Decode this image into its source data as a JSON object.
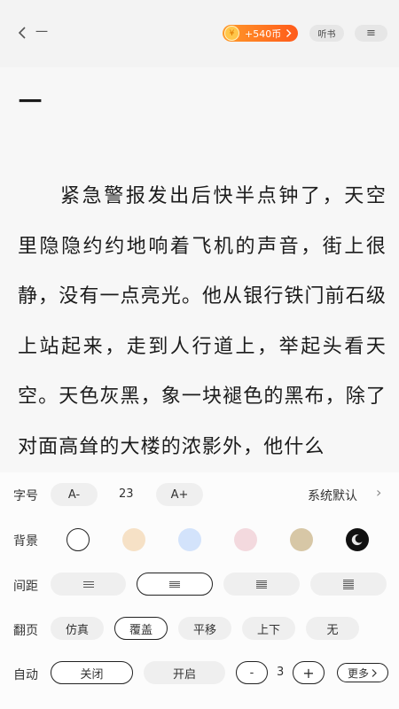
{
  "header": {
    "chapter_label": "一",
    "coin_text": "+540币",
    "coin_glyph": "¥",
    "listen_label": "听书",
    "menu_glyph": "≡"
  },
  "chapter": {
    "title": "一",
    "text": "紧急警报发出后快半点钟了，天空里隐隐约约地响着飞机的声音，街上很静，没有一点亮光。他从银行铁门前石级上站起来，走到人行道上，举起头看天空。天色灰黑，象一块褪色的黑布，除了对面高耸的大楼的浓影外，他什么"
  },
  "settings": {
    "font": {
      "label": "字号",
      "decrease": "A-",
      "size": "23",
      "increase": "A+",
      "typeface": "系统默认",
      "chevron": "›"
    },
    "background": {
      "label": "背景",
      "colors": [
        "#ffffff",
        "#f6e1c6",
        "#d3e3fb",
        "#f3d9de",
        "#d7c7a6",
        "#111111"
      ]
    },
    "spacing": {
      "label": "间距"
    },
    "page_turn": {
      "label": "翻页",
      "options": [
        "仿真",
        "覆盖",
        "平移",
        "上下",
        "无"
      ]
    },
    "auto": {
      "label": "自动",
      "off": "关闭",
      "on": "开启",
      "minus": "-",
      "speed": "3",
      "plus": "+",
      "more": "更多"
    }
  }
}
